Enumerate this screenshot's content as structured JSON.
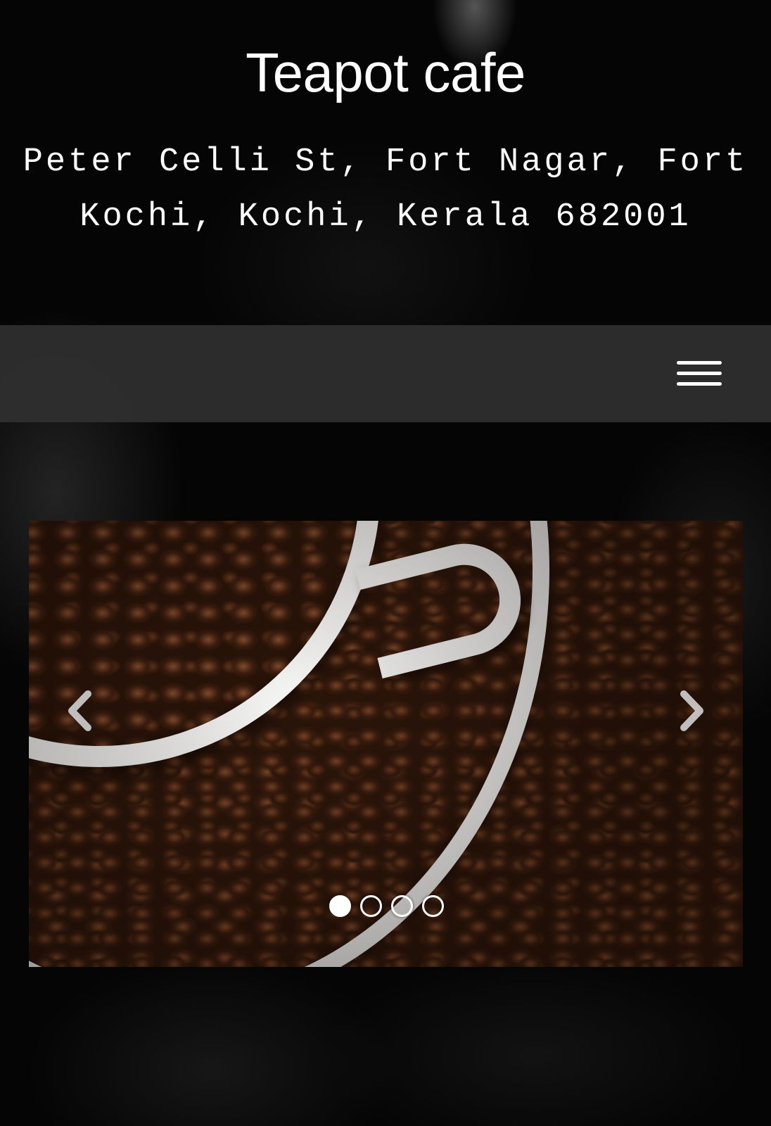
{
  "header": {
    "title": "Teapot cafe",
    "address": "Peter Celli St, Fort Nagar, Fort Kochi, Kochi, Kerala 682001"
  },
  "navbar": {
    "menu_icon": "hamburger-menu-icon"
  },
  "carousel": {
    "current_slide": 1,
    "total_slides": 4,
    "prev_icon": "chevron-left-icon",
    "next_icon": "chevron-right-icon",
    "slide_image": "coffee-beans-in-white-cup"
  },
  "colors": {
    "background": "#050505",
    "navbar": "#303030",
    "text": "#ffffff"
  }
}
